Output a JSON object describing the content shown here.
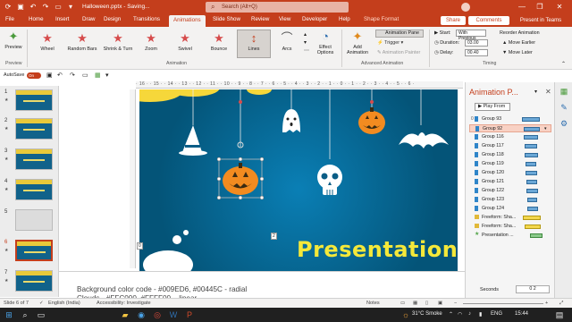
{
  "titlebar": {
    "doc_title": "Halloween.pptx - Saving...",
    "search_placeholder": "Search (Alt+Q)",
    "minimize": "—",
    "maximize": "❐",
    "close": "✕"
  },
  "tabs": [
    "File",
    "Home",
    "Insert",
    "Draw",
    "Design",
    "Transitions",
    "Animations",
    "Slide Show",
    "Review",
    "View",
    "Developer",
    "Help",
    "Shape Format"
  ],
  "tab_buttons": {
    "share": "Share",
    "comments": "Comments",
    "present": "Present in Teams"
  },
  "ribbon": {
    "preview": "Preview",
    "preview_group": "Preview",
    "animations": [
      "Wheel",
      "Random Bars",
      "Shrink & Turn",
      "Zoom",
      "Swivel",
      "Bounce",
      "Lines",
      "Arcs"
    ],
    "animation_group": "Animation",
    "effect_options": "Effect Options",
    "add_animation": "Add Animation",
    "animation_pane": "Animation Pane",
    "trigger": "Trigger",
    "painter": "Animation Painter",
    "advanced_group": "Advanced Animation",
    "start_label": "Start:",
    "start_value": "With Previous",
    "duration_label": "Duration:",
    "duration_value": "03.00",
    "delay_label": "Delay:",
    "delay_value": "00.40",
    "reorder": "Reorder Animation",
    "move_earlier": "Move Earlier",
    "move_later": "Move Later",
    "timing_group": "Timing"
  },
  "toolbar2": {
    "autosave": "AutoSave",
    "autosave_state": "On"
  },
  "ruler_text": "· 16 · · 15 · · 14 · · 13 · · 12 · · 11 · · 10 · · 9 · · 8 · · 7 · · 6 · · 5 · · 4 · · 3 · · 2 · · 1 · · 0 · · 1 · · 2 · · 3 · · 4 · · 5 · · 6 ·",
  "thumbnails": [
    {
      "num": "1"
    },
    {
      "num": "2"
    },
    {
      "num": "3"
    },
    {
      "num": "4"
    },
    {
      "num": "5"
    },
    {
      "num": "6"
    },
    {
      "num": "7"
    }
  ],
  "slide": {
    "title": "Presentation",
    "tag_left": "0",
    "tag_mid": "2"
  },
  "notes": {
    "line1": "Background color code - #009ED6, #00445C - radial",
    "line2": "Clouds - #FFC000, #FFFF00 – linear"
  },
  "animation_pane": {
    "title": "Animation P...",
    "play_from": "Play From",
    "rows": [
      {
        "num": "0",
        "name": "Group 93"
      },
      {
        "num": "",
        "name": "Group 92"
      },
      {
        "num": "",
        "name": "Group 116"
      },
      {
        "num": "",
        "name": "Group 117"
      },
      {
        "num": "",
        "name": "Group 118"
      },
      {
        "num": "",
        "name": "Group 119"
      },
      {
        "num": "",
        "name": "Group 120"
      },
      {
        "num": "",
        "name": "Group 121"
      },
      {
        "num": "",
        "name": "Group 122"
      },
      {
        "num": "",
        "name": "Group 123"
      },
      {
        "num": "",
        "name": "Group 124"
      },
      {
        "num": "",
        "name": "Freeform: Sha..."
      },
      {
        "num": "",
        "name": "Freeform: Sha..."
      },
      {
        "num": "",
        "name": "Presentation ..."
      }
    ],
    "seconds": "Seconds",
    "seconds_range": "0    2"
  },
  "status": {
    "slide_of": "Slide 6 of 7",
    "language": "English (India)",
    "accessibility": "Accessibility: Investigate",
    "notes": "Notes",
    "zoom": "+"
  },
  "taskbar": {
    "weather": "31°C  Smoke",
    "time": "15:44",
    "lang": "ENG"
  }
}
